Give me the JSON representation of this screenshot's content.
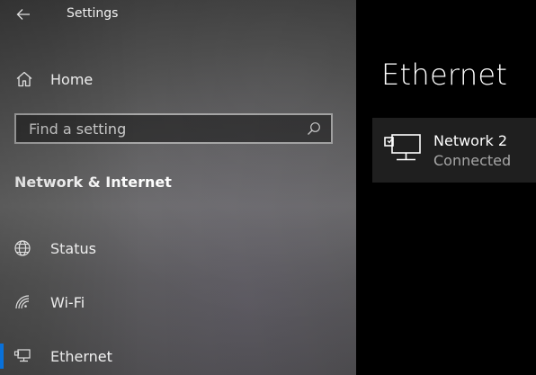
{
  "window": {
    "title": "Settings"
  },
  "sidebar": {
    "home_label": "Home",
    "search": {
      "placeholder": "Find a setting",
      "value": ""
    },
    "section_title": "Network & Internet",
    "items": [
      {
        "label": "Status",
        "icon": "globe-icon",
        "selected": false
      },
      {
        "label": "Wi-Fi",
        "icon": "wifi-icon",
        "selected": false
      },
      {
        "label": "Ethernet",
        "icon": "ethernet-icon",
        "selected": true
      }
    ]
  },
  "content": {
    "page_title": "Ethernet",
    "network": {
      "name": "Network 2",
      "status": "Connected",
      "icon": "ethernet-network-icon"
    }
  },
  "colors": {
    "accent": "#0a84ff",
    "content_background": "#000000",
    "tile_background": "#1f1f1f",
    "secondary_text": "#a6a6a6"
  }
}
